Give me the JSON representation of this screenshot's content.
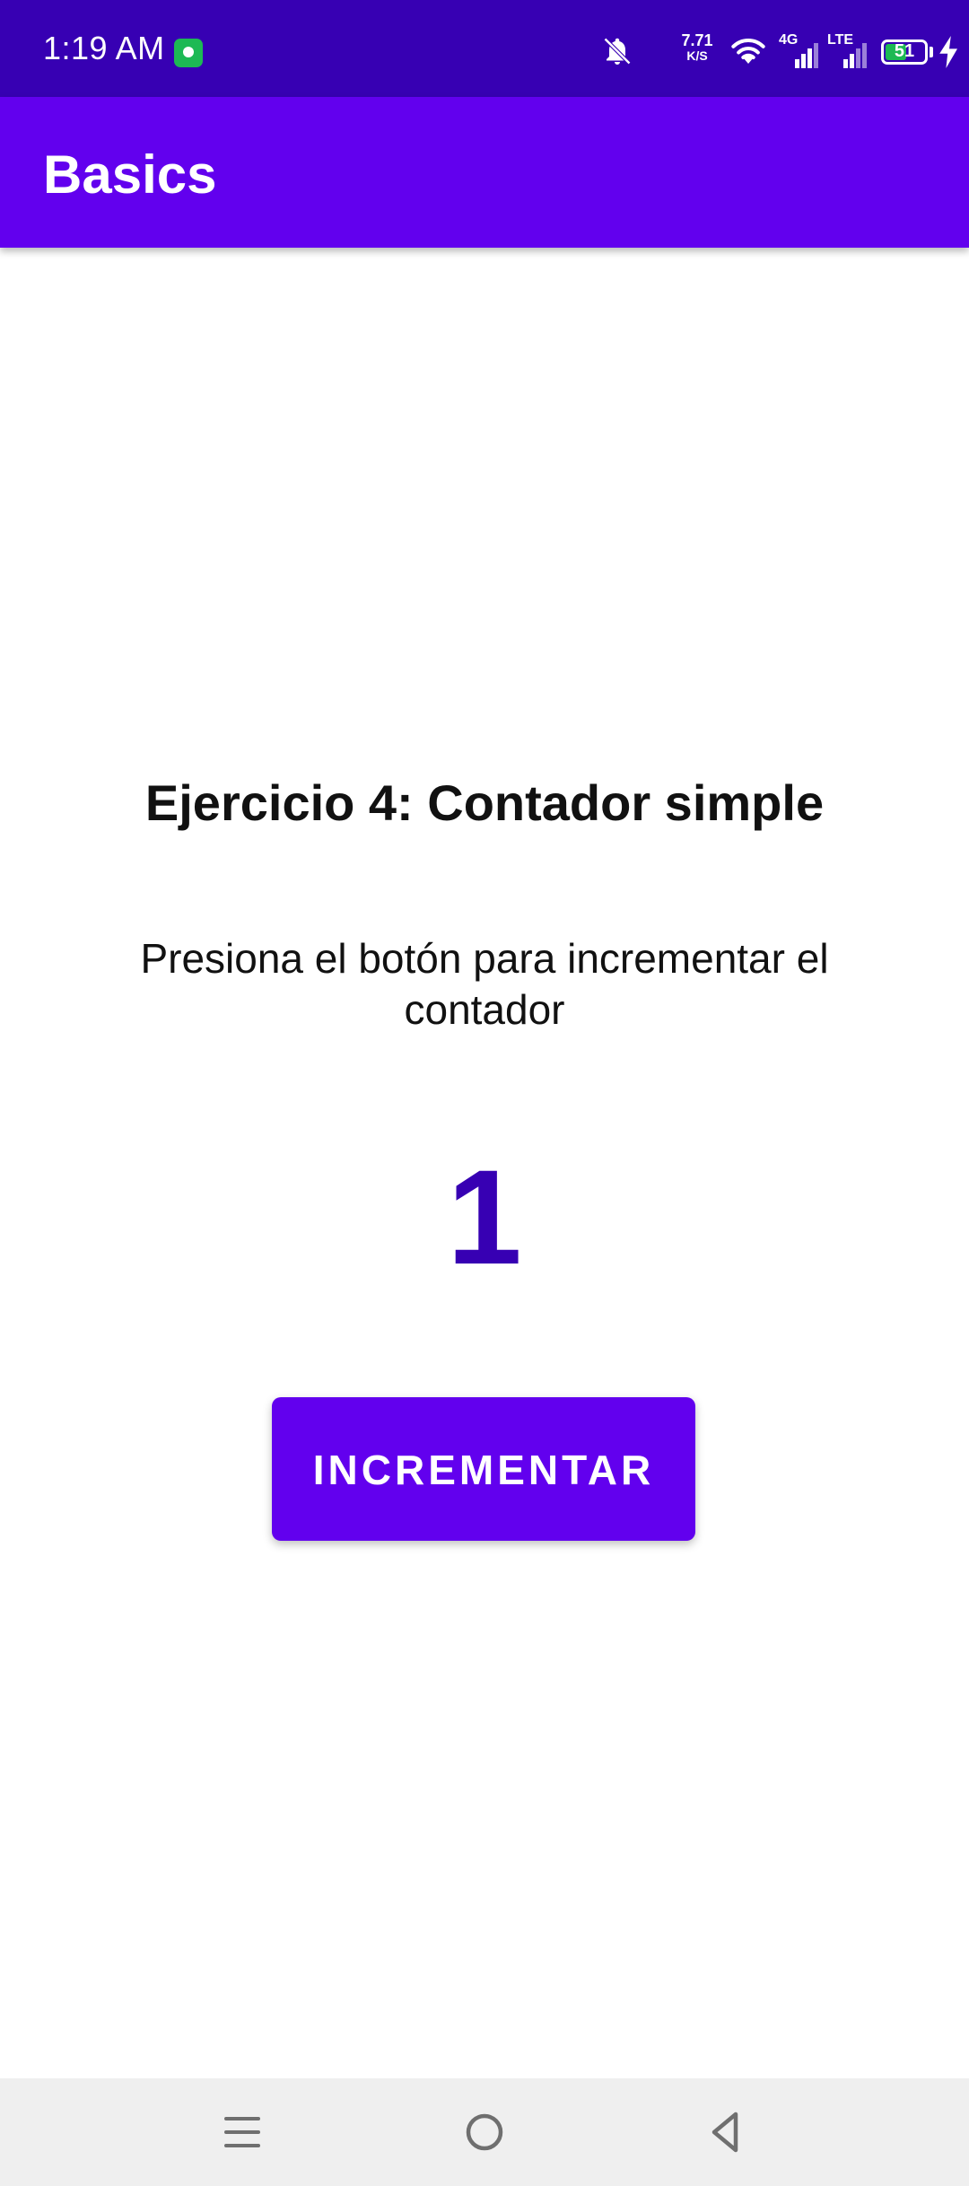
{
  "status_bar": {
    "time": "1:19 AM",
    "net_speed_value": "7.71",
    "net_speed_unit": "K/S",
    "network_tag_1": "4G",
    "network_tag_2": "LTE",
    "battery_level": "51",
    "icons": [
      "app-notification-icon",
      "bell-muted-icon",
      "wifi-icon",
      "signal-icon",
      "battery-icon",
      "charging-icon"
    ]
  },
  "app_bar": {
    "title": "Basics"
  },
  "main": {
    "title": "Ejercicio 4: Contador simple",
    "subtitle": "Presiona el botón para incrementar el contador",
    "counter_value": "1",
    "button_label": "INCREMENTAR"
  },
  "nav_bar": {
    "icons": [
      "menu-icon",
      "home-icon",
      "back-icon"
    ]
  },
  "colors": {
    "status_bar": "#3700b3",
    "primary": "#6200ee",
    "counter": "#3700b3",
    "nav_background": "#efefef"
  }
}
